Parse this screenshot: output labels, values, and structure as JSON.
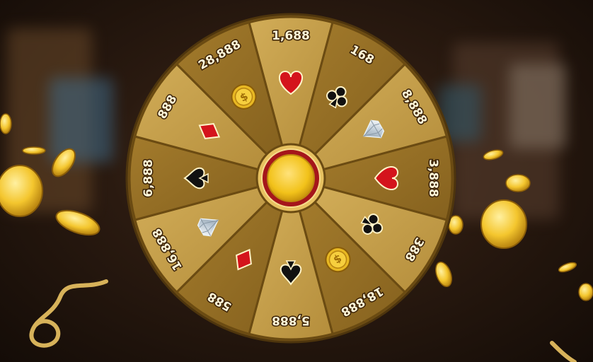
{
  "wheel": {
    "segments": [
      {
        "label": "1,688",
        "icon": "heart-icon"
      },
      {
        "label": "168",
        "icon": "club-icon"
      },
      {
        "label": "8,888",
        "icon": "diamond-gem-icon"
      },
      {
        "label": "3,888",
        "icon": "heart-icon"
      },
      {
        "label": "388",
        "icon": "club-icon"
      },
      {
        "label": "18,888",
        "icon": "coin-icon"
      },
      {
        "label": "5,888",
        "icon": "spade-icon"
      },
      {
        "label": "588",
        "icon": "diamond-suit-icon"
      },
      {
        "label": "16,888",
        "icon": "diamond-gem-icon"
      },
      {
        "label": "6,888",
        "icon": "spade-icon"
      },
      {
        "label": "888",
        "icon": "diamond-suit-icon"
      },
      {
        "label": "28,888",
        "icon": "coin-icon"
      }
    ],
    "colors": {
      "gold_light": "#c9a24a",
      "gold_dark": "#8f6a22",
      "red": "#d4141c",
      "black": "#111111",
      "hub": "#f2c21a"
    }
  }
}
